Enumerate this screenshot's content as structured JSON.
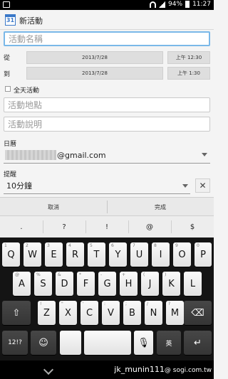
{
  "status_bar": {
    "battery": "94%",
    "time": "11:27"
  },
  "action_bar": {
    "icon_text": "31",
    "title": "新活動"
  },
  "form": {
    "title_placeholder": "活動名稱",
    "from_label": "從",
    "from_date": "2013/7/28",
    "from_time": "上午 12:30",
    "to_label": "到",
    "to_date": "2013/7/28",
    "to_time": "上午 1:30",
    "allday_label": "全天活動",
    "location_placeholder": "活動地點",
    "description_placeholder": "活動說明",
    "calendar_label": "日曆",
    "calendar_value": "@gmail.com",
    "reminder_label": "提醒",
    "reminder_value": "10分鐘",
    "remove_symbol": "✕"
  },
  "actions": {
    "cancel": "取消",
    "done": "完成"
  },
  "symbols": [
    ".",
    "?",
    "!",
    "@",
    "$"
  ],
  "keyboard": {
    "row1": [
      {
        "k": "Q",
        "h": "1"
      },
      {
        "k": "W",
        "h": "2"
      },
      {
        "k": "E",
        "h": "3"
      },
      {
        "k": "R",
        "h": "4"
      },
      {
        "k": "T",
        "h": "5"
      },
      {
        "k": "Y",
        "h": "6"
      },
      {
        "k": "U",
        "h": "7"
      },
      {
        "k": "I",
        "h": "8"
      },
      {
        "k": "O",
        "h": "9"
      },
      {
        "k": "P",
        "h": "0"
      }
    ],
    "row2": [
      {
        "k": "A",
        "h": "@"
      },
      {
        "k": "S",
        "h": "%"
      },
      {
        "k": "D",
        "h": "&"
      },
      {
        "k": "F",
        "h": "*"
      },
      {
        "k": "G",
        "h": "-"
      },
      {
        "k": "H",
        "h": "+"
      },
      {
        "k": "J",
        "h": "("
      },
      {
        "k": "K",
        "h": ")"
      },
      {
        "k": "L",
        "h": ""
      }
    ],
    "row3": [
      {
        "k": "Z",
        "h": "!"
      },
      {
        "k": "X",
        "h": "\""
      },
      {
        "k": "C",
        "h": "'"
      },
      {
        "k": "V",
        "h": ":"
      },
      {
        "k": "B",
        "h": ";"
      },
      {
        "k": "N",
        "h": "/"
      },
      {
        "k": "M",
        "h": "?"
      }
    ],
    "shift": "⇧",
    "backspace": "⌫",
    "num_key": "12!?",
    "emoji": "☺",
    "mic": "🎙",
    "lang": "英",
    "enter": "↵"
  },
  "watermark": {
    "part1": "jk_munin111",
    "part2": "@ sogi.com.tw"
  }
}
